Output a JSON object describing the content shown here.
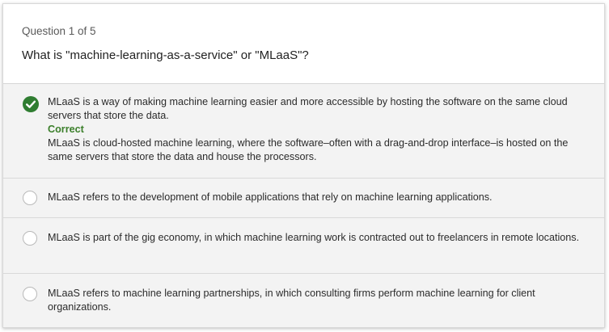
{
  "quiz": {
    "progress": "Question 1 of 5",
    "question": "What is \"machine-learning-as-a-service\" or \"MLaaS\"?",
    "options": [
      {
        "text": "MLaaS is a way of making machine learning easier and more accessible by hosting the software on the same cloud servers that store the data.",
        "selected": true,
        "feedback_label": "Correct",
        "feedback": "MLaaS is cloud-hosted machine learning, where the software–often with a drag-and-drop interface–is hosted on the same servers that store the data and house the processors."
      },
      {
        "text": "MLaaS refers to the development of mobile applications that rely on machine learning applications.",
        "selected": false
      },
      {
        "text": "MLaaS is part of the gig economy, in which machine learning work is contracted out to freelancers in remote locations.",
        "selected": false
      },
      {
        "text": "MLaaS refers to machine learning partnerships, in which consulting firms perform machine learning for client organizations.",
        "selected": false
      }
    ]
  },
  "colors": {
    "correct_green": "#2f7d31",
    "correct_text": "#3b7f2a"
  }
}
